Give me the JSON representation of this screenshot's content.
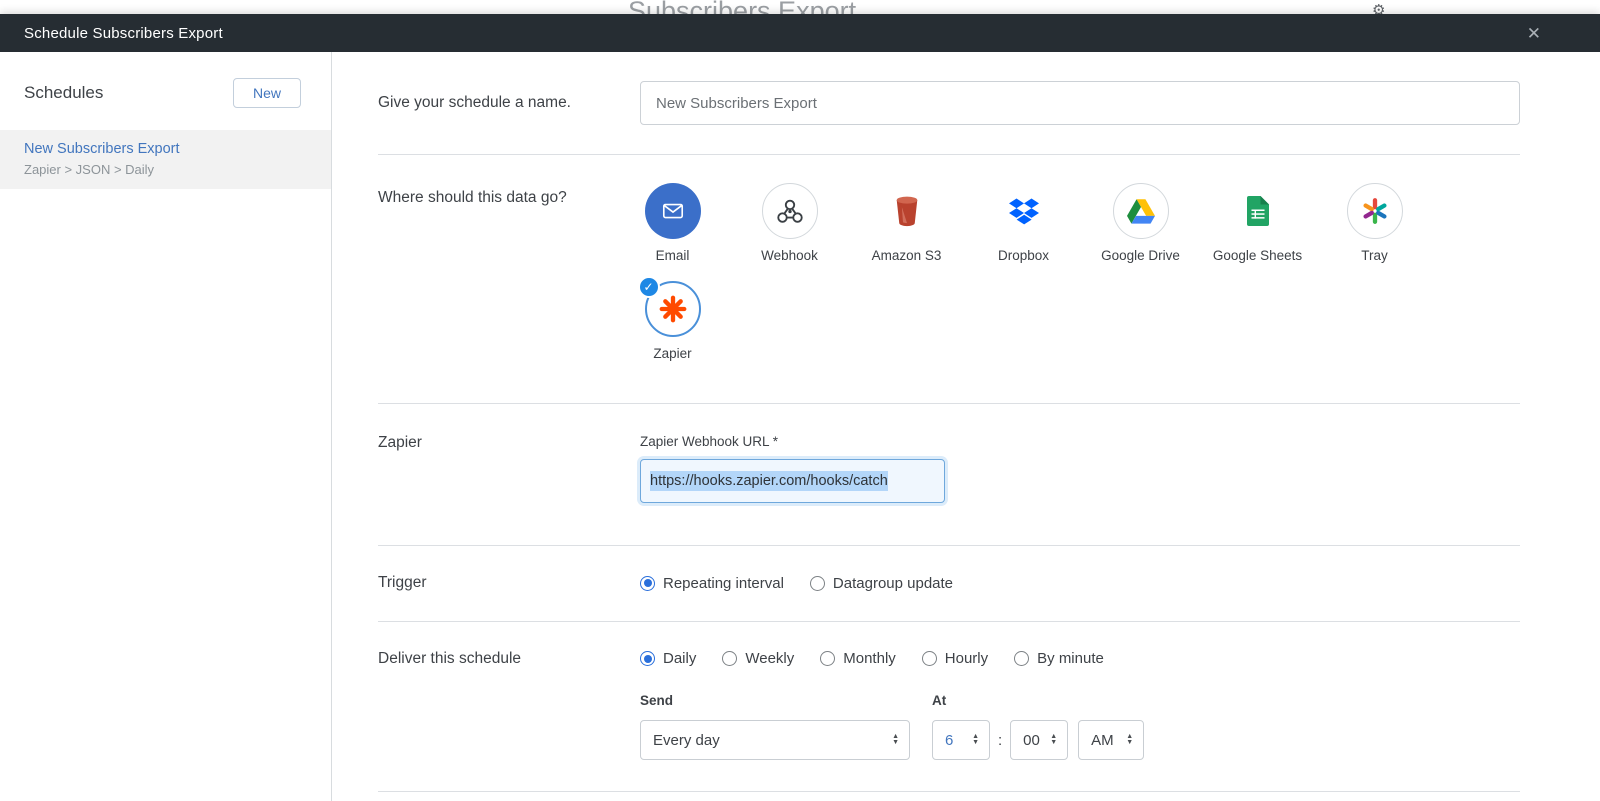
{
  "background": {
    "page_title": "Subscribers Export"
  },
  "modal": {
    "title": "Schedule Subscribers Export"
  },
  "icons": {
    "close": "✕",
    "check": "✓",
    "gear": "⚙",
    "up": "▲",
    "down": "▼"
  },
  "sidebar": {
    "heading": "Schedules",
    "new_button_label": "New",
    "schedules": [
      {
        "title": "New Subscribers Export",
        "subtitle": "Zapier > JSON > Daily",
        "selected": true
      }
    ]
  },
  "form": {
    "name_section": {
      "label": "Give your schedule a name.",
      "value": "New Subscribers Export"
    },
    "destination_section": {
      "label": "Where should this data go?",
      "options": [
        {
          "name": "Email",
          "selected": false
        },
        {
          "name": "Webhook",
          "selected": false
        },
        {
          "name": "Amazon S3",
          "selected": false
        },
        {
          "name": "Dropbox",
          "selected": false
        },
        {
          "name": "Google Drive",
          "selected": false
        },
        {
          "name": "Google Sheets",
          "selected": false
        },
        {
          "name": "Tray",
          "selected": false
        },
        {
          "name": "Zapier",
          "selected": true
        }
      ]
    },
    "zapier_section": {
      "label": "Zapier",
      "field_label": "Zapier Webhook URL *",
      "value": "https://hooks.zapier.com/hooks/catch"
    },
    "trigger_section": {
      "label": "Trigger",
      "options": [
        {
          "label": "Repeating interval",
          "selected": true
        },
        {
          "label": "Datagroup update",
          "selected": false
        }
      ]
    },
    "deliver_section": {
      "label": "Deliver this schedule",
      "options": [
        {
          "label": "Daily",
          "selected": true
        },
        {
          "label": "Weekly",
          "selected": false
        },
        {
          "label": "Monthly",
          "selected": false
        },
        {
          "label": "Hourly",
          "selected": false
        },
        {
          "label": "By minute",
          "selected": false
        }
      ],
      "send": {
        "label": "Send",
        "value": "Every day"
      },
      "at": {
        "label": "At",
        "hour": "6",
        "separator": ":",
        "minute": "00",
        "meridiem": "AM"
      }
    }
  },
  "colors": {
    "accent_blue": "#4276be",
    "header_bg": "#262d33",
    "radio_blue": "#2a6fdb",
    "zapier_orange": "#ff4a00",
    "check_badge_blue": "#1e88e5"
  }
}
